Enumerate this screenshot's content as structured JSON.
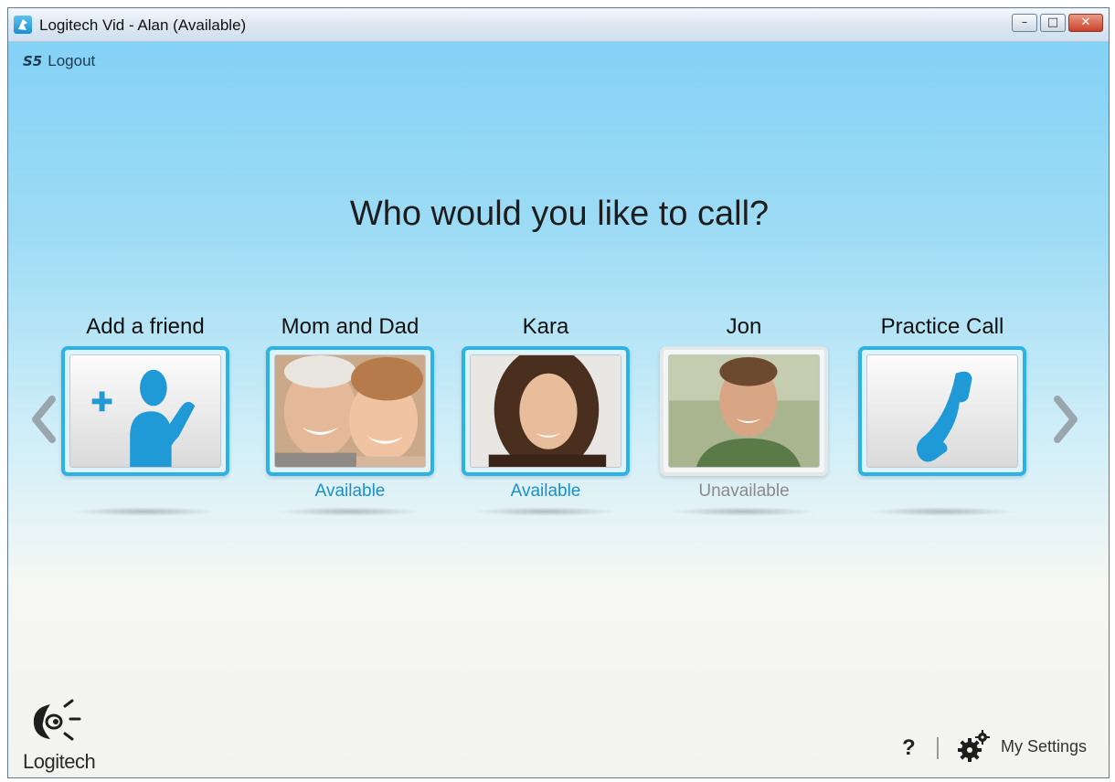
{
  "window": {
    "title": "Logitech Vid - Alan (Available)"
  },
  "header": {
    "logout_label": "Logout",
    "logout_icon": "logout-icon"
  },
  "main": {
    "prompt": "Who would you like to call?",
    "contacts": [
      {
        "name": "Add a friend",
        "status": "",
        "icon": "add-friend-icon"
      },
      {
        "name": "Mom and Dad",
        "status": "Available"
      },
      {
        "name": "Kara",
        "status": "Available"
      },
      {
        "name": "Jon",
        "status": "Unavailable"
      },
      {
        "name": "Practice Call",
        "status": "",
        "icon": "phone-icon"
      }
    ]
  },
  "footer": {
    "brand": "Logitech",
    "help_label": "?",
    "settings_label": "My Settings"
  },
  "colors": {
    "accent": "#2bb3e6",
    "available": "#1b8fc9",
    "unavailable": "#8a8a8a"
  }
}
